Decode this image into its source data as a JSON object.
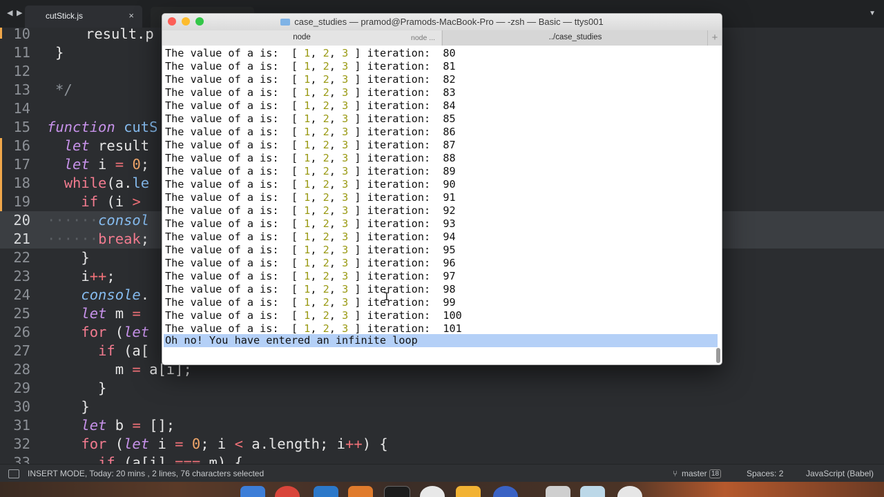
{
  "editor": {
    "tab": {
      "label": "cutStick.js",
      "close": "×"
    },
    "nav": {
      "back": "◀",
      "forward": "▶"
    },
    "menu_arrow": "▼",
    "lines": [
      {
        "n": "10",
        "html": "<span style=\"padding-left:56px\">result.p</span>"
      },
      {
        "n": "11",
        "html": "<span style=\"padding-left:12px\">}</span>"
      },
      {
        "n": "12",
        "html": ""
      },
      {
        "n": "13",
        "html": "<span class=\"c\" style=\"padding-left:12px\">*/</span>"
      },
      {
        "n": "14",
        "html": ""
      },
      {
        "n": "15",
        "html": "<span class=\"k\">function</span> <span class=\"fn\">cutS</span>"
      },
      {
        "n": "16",
        "html": "  <span class=\"k\">let</span> result"
      },
      {
        "n": "17",
        "html": "  <span class=\"k\">let</span> i <span class=\"op\">=</span> <span class=\"n\">0</span>;"
      },
      {
        "n": "18",
        "html": "  <span class=\"kw\">while</span>(a.<span class=\"fn\">le</span>"
      },
      {
        "n": "19",
        "html": "    <span class=\"kw\">if</span> (i <span class=\"op\">&gt;</span>"
      },
      {
        "n": "20",
        "html": "<span class=\"ws\">······</span><span class=\"fn\" style=\"font-style:italic\">consol</span>",
        "hl": true
      },
      {
        "n": "21",
        "html": "<span class=\"ws\">······</span><span class=\"kw\">break</span>;",
        "hl": true
      },
      {
        "n": "22",
        "html": "    }"
      },
      {
        "n": "23",
        "html": "    i<span class=\"op\">++</span>;"
      },
      {
        "n": "24",
        "html": "    <span class=\"fn\" style=\"font-style:italic\">console</span>."
      },
      {
        "n": "25",
        "html": "    <span class=\"k\">let</span> m <span class=\"op\">=</span>"
      },
      {
        "n": "26",
        "html": "    <span class=\"kw\">for</span> (<span class=\"k\">let</span>"
      },
      {
        "n": "27",
        "html": "      <span class=\"kw\">if</span> (a["
      },
      {
        "n": "28",
        "html": "        m <span class=\"op\">=</span> a[i];"
      },
      {
        "n": "29",
        "html": "      }"
      },
      {
        "n": "30",
        "html": "    }"
      },
      {
        "n": "31",
        "html": "    <span class=\"k\">let</span> b <span class=\"op\">=</span> [];"
      },
      {
        "n": "32",
        "html": "    <span class=\"kw\">for</span> (<span class=\"k\">let</span> i <span class=\"op\">=</span> <span class=\"n\">0</span>; i <span class=\"op\">&lt;</span> a.length; i<span class=\"op\">++</span>) {"
      },
      {
        "n": "33",
        "html": "      <span class=\"kw\">if</span> (a[i] <span class=\"op\">===</span> m) {"
      }
    ]
  },
  "status": {
    "mode": "INSERT MODE, Today: 20 mins , 2 lines, 76 characters selected",
    "branch": "master",
    "branch_count": "18",
    "spaces": "Spaces: 2",
    "syntax": "JavaScript (Babel)"
  },
  "terminal": {
    "title": "case_studies — pramod@Pramods-MacBook-Pro — -zsh — Basic — ttys001",
    "tabs": [
      {
        "label": "node",
        "sub": "node ..."
      },
      {
        "label": "../case_studies"
      }
    ],
    "add_tab": "+",
    "output_prefix": "The value of a is:  [ ",
    "output_nums": [
      "1",
      "2",
      "3"
    ],
    "output_mid": " ] iteration:  ",
    "iterations": [
      "80",
      "81",
      "82",
      "83",
      "84",
      "85",
      "86",
      "87",
      "88",
      "89",
      "90",
      "91",
      "92",
      "93",
      "94",
      "95",
      "96",
      "97",
      "98",
      "99",
      "100",
      "101"
    ],
    "message": "Oh no! You have entered an infinite loop",
    "colors": {
      "close": "#fc5f57",
      "minimize": "#fdbc2e",
      "zoom": "#33c748"
    }
  }
}
